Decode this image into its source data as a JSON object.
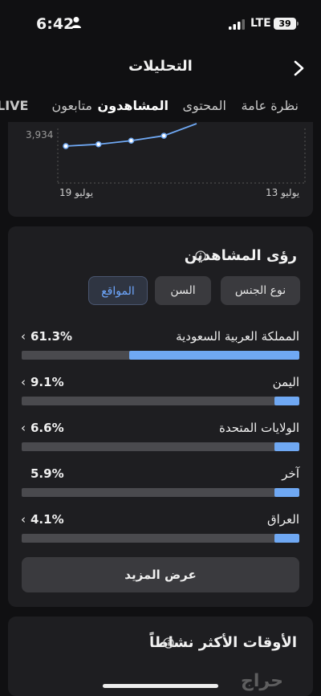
{
  "status_bar": {
    "time": "6:42",
    "network": "LTE",
    "battery": "39"
  },
  "header": {
    "title": "التحليلات"
  },
  "tabs": [
    {
      "label": "نظرة عامة"
    },
    {
      "label": "المحتوى"
    },
    {
      "label": "المشاهدون"
    },
    {
      "label": "متابعون"
    },
    {
      "label": "LIVE"
    }
  ],
  "active_tab": "المشاهدون",
  "chart_data": {
    "type": "line",
    "y_tick_label": "3,934",
    "x_labels": [
      "يوليو 19",
      "يوليو 13"
    ],
    "points": [
      3934,
      3960,
      4010,
      4080,
      4250
    ]
  },
  "viewers": {
    "title": "رؤى المشاهدين",
    "filters": [
      "نوع الجنس",
      "السن",
      "المواقع"
    ],
    "selected_filter": "المواقع",
    "locations": [
      {
        "name": "المملكة العربية السعودية",
        "percent_label": "61.3%",
        "percent": 61.3,
        "chevron": true
      },
      {
        "name": "اليمن",
        "percent_label": "9.1%",
        "percent": 9.1,
        "chevron": true
      },
      {
        "name": "الولايات المتحدة",
        "percent_label": "6.6%",
        "percent": 6.6,
        "chevron": true
      },
      {
        "name": "آخر",
        "percent_label": "5.9%",
        "percent": 5.9,
        "chevron": false
      },
      {
        "name": "العراق",
        "percent_label": "4.1%",
        "percent": 4.1,
        "chevron": true
      }
    ],
    "more_button": "عرض المزيد"
  },
  "active_times": {
    "title": "الأوقات الأكثر نشاطاً"
  },
  "watermark": "حراج",
  "colors": {
    "accent": "#6fa8f3",
    "card": "#1e1e21",
    "background": "#101012"
  }
}
